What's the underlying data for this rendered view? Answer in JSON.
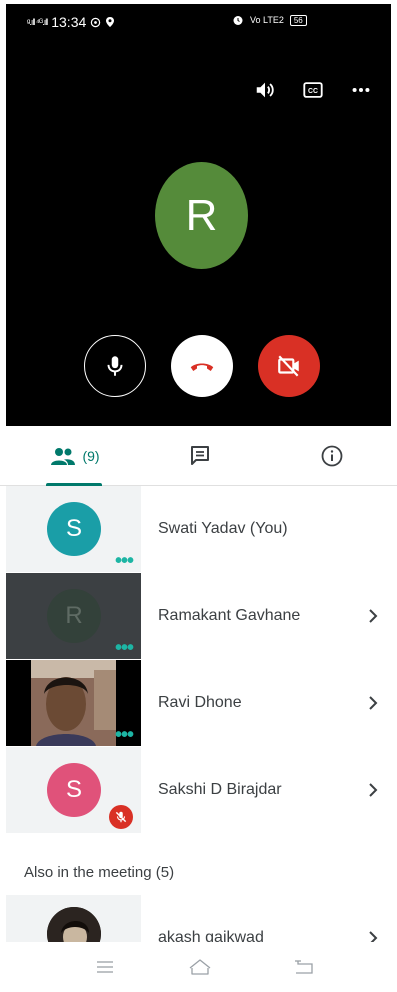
{
  "status_bar": {
    "signal": "ᵍ.ıll ⁴ᴳ.ıll",
    "time": "13:34",
    "volte": "Vo LTE2",
    "battery": "56"
  },
  "call": {
    "main_avatar_letter": "R",
    "main_avatar_color": "#558b3a",
    "controls": [
      "volume-icon",
      "captions-icon",
      "more-icon"
    ],
    "buttons": [
      "mic-icon",
      "end-call-icon",
      "camera-off-icon"
    ]
  },
  "tabs": {
    "people_count": "(9)",
    "chat_icon": "chat-icon",
    "info_icon": "info-icon",
    "accent": "#00796b"
  },
  "participants": [
    {
      "name": "Swati Yadav (You)",
      "letter": "S",
      "color": "#1a9ea7"
    },
    {
      "name": "Ramakant Gavhane",
      "letter": "R",
      "color": "#33413a"
    },
    {
      "name": "Ravi Dhone",
      "letter": "",
      "color": ""
    },
    {
      "name": "Sakshi D Birajdar",
      "letter": "S",
      "color": "#e0527a"
    }
  ],
  "also_in_meeting": {
    "label": "Also in the meeting (5)",
    "first": {
      "name": "akash gaikwad"
    }
  },
  "nav": [
    "menu-icon",
    "home-icon",
    "back-icon"
  ]
}
